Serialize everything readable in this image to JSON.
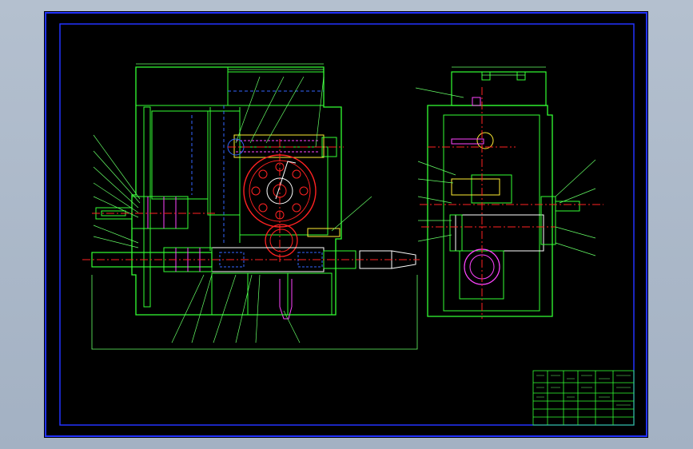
{
  "colors": {
    "background": "#000000",
    "viewport": "#a9b6c6",
    "frame": "#2233ff",
    "outline": "#33ff33",
    "hidden": "#3366ff",
    "centerline": "#ff2222",
    "hatch": "#ff44ff",
    "dimension": "#66ff66",
    "yellow": "#ffee33",
    "white": "#ffffff"
  },
  "icons": {
    "spindle_icon": "spindle-icon",
    "gear_icon": "gear-icon",
    "shaft_icon": "shaft-icon"
  }
}
